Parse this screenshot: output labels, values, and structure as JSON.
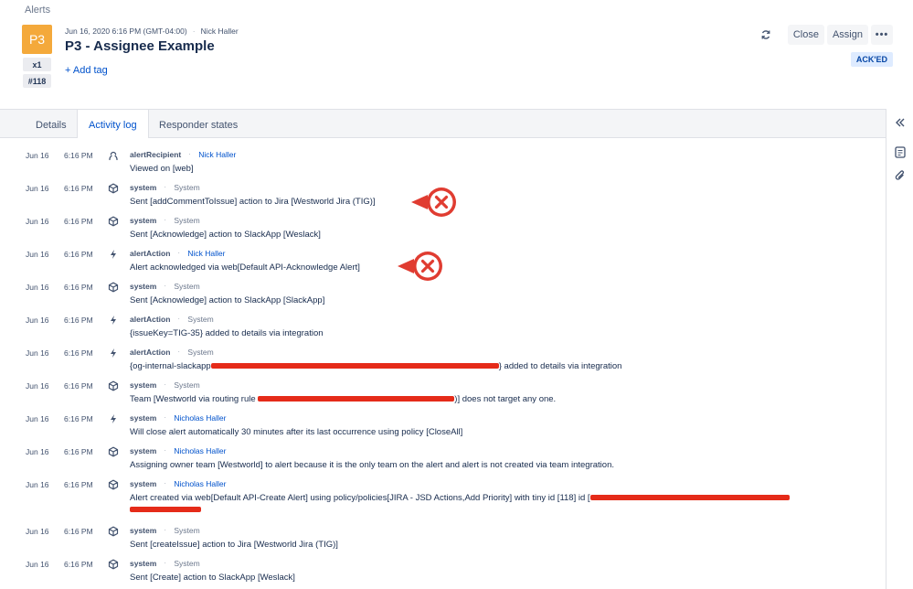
{
  "breadcrumb": "Alerts",
  "alert": {
    "priority": "P3",
    "count": "x1",
    "tiny_id": "#118",
    "timestamp": "Jun 16, 2020 6:16 PM (GMT-04:00)",
    "owner": "Nick Haller",
    "title": "P3 - Assignee Example",
    "add_tag": "+ Add tag",
    "status": "ACK'ED",
    "priority_color": "#f4a93b"
  },
  "actions": {
    "refresh_icon": "refresh-icon",
    "close": "Close",
    "assign": "Assign",
    "more": "•••"
  },
  "tabs": [
    "Details",
    "Activity log",
    "Responder states"
  ],
  "active_tab": "Activity log",
  "log": [
    {
      "date": "Jun 16",
      "time": "6:16 PM",
      "icon": "person-icon",
      "actor": "alertRecipient",
      "who": "Nick Haller",
      "who_link": true,
      "message": "Viewed on [web]"
    },
    {
      "date": "Jun 16",
      "time": "6:16 PM",
      "icon": "cube-icon",
      "actor": "system",
      "who": "System",
      "who_link": false,
      "message": "Sent [addCommentToIssue] action to Jira [Westworld Jira (TIG)]"
    },
    {
      "date": "Jun 16",
      "time": "6:16 PM",
      "icon": "cube-icon",
      "actor": "system",
      "who": "System",
      "who_link": false,
      "message": "Sent [Acknowledge] action to SlackApp [Weslack]"
    },
    {
      "date": "Jun 16",
      "time": "6:16 PM",
      "icon": "lightning-icon",
      "actor": "alertAction",
      "who": "Nick Haller",
      "who_link": true,
      "message": "Alert acknowledged via web[Default API-Acknowledge Alert]"
    },
    {
      "date": "Jun 16",
      "time": "6:16 PM",
      "icon": "cube-icon",
      "actor": "system",
      "who": "System",
      "who_link": false,
      "message": "Sent [Acknowledge] action to SlackApp [SlackApp]"
    },
    {
      "date": "Jun 16",
      "time": "6:16 PM",
      "icon": "lightning-icon",
      "actor": "alertAction",
      "who": "System",
      "who_link": false,
      "message": "{issueKey=TIG-35} added to details via integration"
    },
    {
      "date": "Jun 16",
      "time": "6:16 PM",
      "icon": "lightning-icon",
      "actor": "alertAction",
      "who": "System",
      "who_link": false,
      "message_pre": "{og-internal-slackapp",
      "message_post": "} added to details via integration"
    },
    {
      "date": "Jun 16",
      "time": "6:16 PM",
      "icon": "cube-icon",
      "actor": "system",
      "who": "System",
      "who_link": false,
      "message_pre": "Team [Westworld via routing rule ",
      "message_post": ")] does not target any one."
    },
    {
      "date": "Jun 16",
      "time": "6:16 PM",
      "icon": "lightning-icon",
      "actor": "system",
      "who": "Nicholas Haller",
      "who_link": true,
      "message": "Will close alert automatically 30 minutes after its last occurrence using policy [CloseAll]"
    },
    {
      "date": "Jun 16",
      "time": "6:16 PM",
      "icon": "cube-icon",
      "actor": "system",
      "who": "Nicholas Haller",
      "who_link": true,
      "message": "Assigning owner team [Westworld] to alert because it is the only team on the alert and alert is not created via team integration."
    },
    {
      "date": "Jun 16",
      "time": "6:16 PM",
      "icon": "cube-icon",
      "actor": "system",
      "who": "Nicholas Haller",
      "who_link": true,
      "message_pre": "Alert created via web[Default API-Create Alert] using policy/policies[JIRA - JSD Actions,Add Priority] with tiny id [118] id [",
      "message_post": ""
    },
    {
      "date": "Jun 16",
      "time": "6:16 PM",
      "icon": "cube-icon",
      "actor": "system",
      "who": "System",
      "who_link": false,
      "message": "Sent [createIssue] action to Jira [Westworld Jira (TIG)]"
    },
    {
      "date": "Jun 16",
      "time": "6:16 PM",
      "icon": "cube-icon",
      "actor": "system",
      "who": "System",
      "who_link": false,
      "message": "Sent [Create] action to SlackApp [Weslack]"
    }
  ],
  "rail": [
    "collapse-icon",
    "notes-icon",
    "attachment-icon"
  ],
  "colors": {
    "accent": "#0052cc",
    "callout": "#e03c31",
    "redaction": "#e52b19"
  }
}
